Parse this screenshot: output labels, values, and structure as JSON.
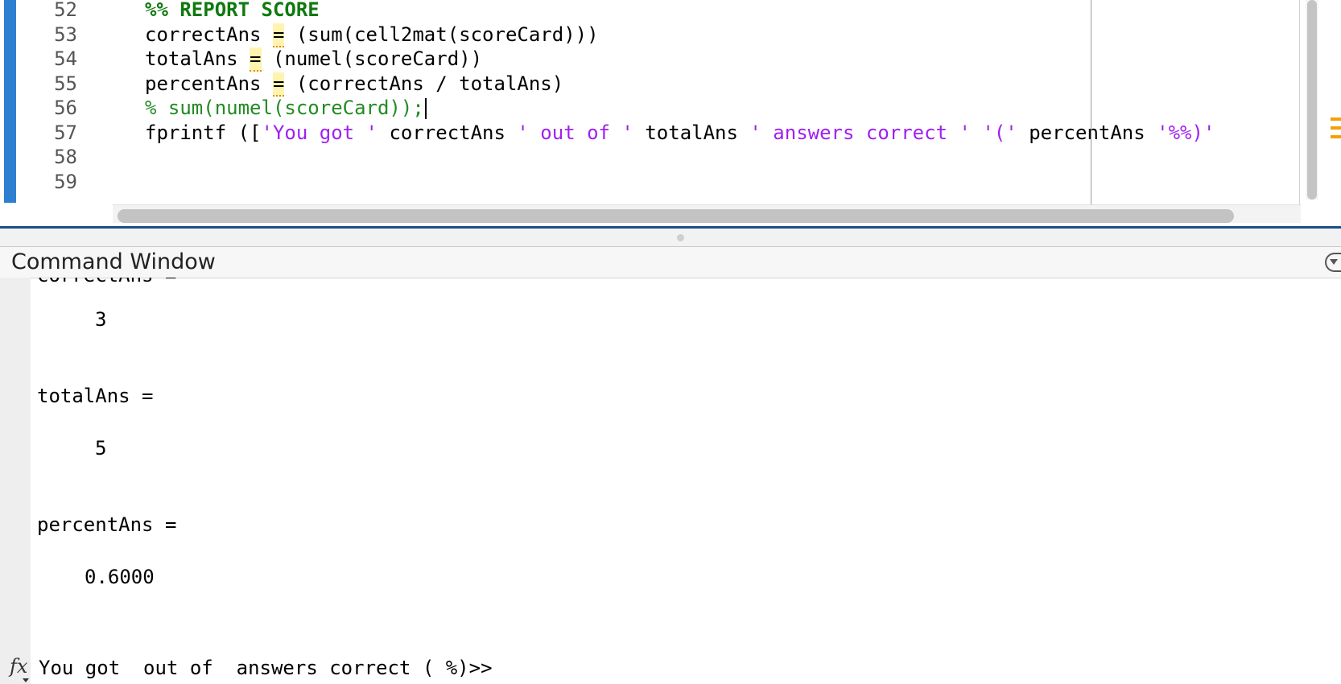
{
  "editor": {
    "lines": [
      {
        "num": "52",
        "tokens": [
          {
            "t": "%% REPORT SCORE",
            "k": "cell"
          }
        ]
      },
      {
        "num": "53",
        "tokens": [
          {
            "t": "correctAns ",
            "k": "plain"
          },
          {
            "t": "=",
            "k": "warn"
          },
          {
            "t": " (sum(cell2mat(scoreCard)))",
            "k": "plain"
          }
        ]
      },
      {
        "num": "54",
        "tokens": [
          {
            "t": "totalAns ",
            "k": "plain"
          },
          {
            "t": "=",
            "k": "warn"
          },
          {
            "t": " (numel(scoreCard))",
            "k": "plain"
          }
        ]
      },
      {
        "num": "55",
        "tokens": [
          {
            "t": "percentAns ",
            "k": "plain"
          },
          {
            "t": "=",
            "k": "warn"
          },
          {
            "t": " (correctAns / totalAns)",
            "k": "plain"
          }
        ]
      },
      {
        "num": "56",
        "tokens": [
          {
            "t": "% sum(numel(scoreCard));",
            "k": "comment"
          },
          {
            "t": "",
            "k": "caret"
          }
        ]
      },
      {
        "num": "57",
        "tokens": [
          {
            "t": "fprintf ([",
            "k": "plain"
          },
          {
            "t": "'You got '",
            "k": "str"
          },
          {
            "t": " correctAns ",
            "k": "plain"
          },
          {
            "t": "' out of '",
            "k": "str"
          },
          {
            "t": " totalAns ",
            "k": "plain"
          },
          {
            "t": "' answers correct '",
            "k": "str"
          },
          {
            "t": " ",
            "k": "plain"
          },
          {
            "t": "'('",
            "k": "str"
          },
          {
            "t": " percentAns ",
            "k": "plain"
          },
          {
            "t": "'%%)'",
            "k": "str"
          }
        ]
      },
      {
        "num": "58",
        "tokens": []
      },
      {
        "num": "59",
        "tokens": []
      }
    ]
  },
  "command_window": {
    "title": "Command Window",
    "output": [
      {
        "text": "correctAns =",
        "indent": 8
      },
      {
        "text": "3",
        "indent": 80
      },
      {
        "text": "totalAns =",
        "indent": 8
      },
      {
        "text": "5",
        "indent": 80
      },
      {
        "text": "percentAns =",
        "indent": 8
      },
      {
        "text": "0.6000",
        "indent": 67
      }
    ],
    "prompt_line": "You got  out of  answers correct ( %)>>",
    "prompt_icon": "fx-icon"
  },
  "colors": {
    "accent_bar": "#2f7fd0",
    "cell_title": "#0f7a0f",
    "comment": "#228b22",
    "string": "#a020f0",
    "warning": "#f5a000"
  }
}
